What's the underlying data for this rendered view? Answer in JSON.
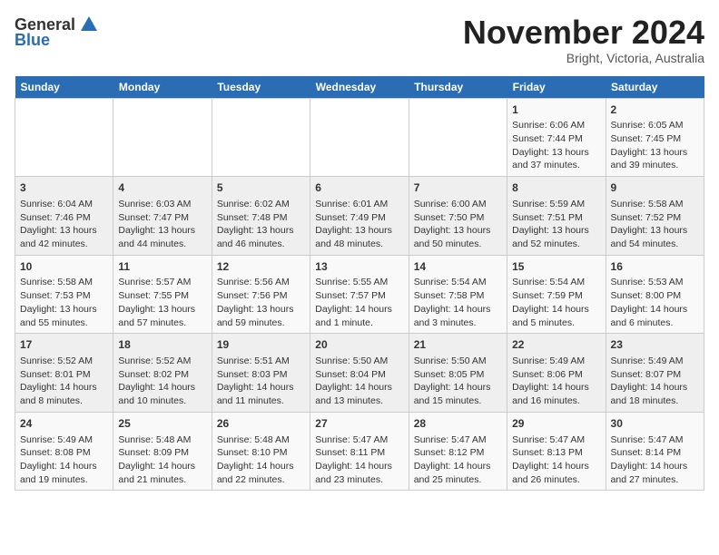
{
  "header": {
    "logo_general": "General",
    "logo_blue": "Blue",
    "month_year": "November 2024",
    "location": "Bright, Victoria, Australia"
  },
  "weekdays": [
    "Sunday",
    "Monday",
    "Tuesday",
    "Wednesday",
    "Thursday",
    "Friday",
    "Saturday"
  ],
  "weeks": [
    [
      {
        "day": "",
        "content": ""
      },
      {
        "day": "",
        "content": ""
      },
      {
        "day": "",
        "content": ""
      },
      {
        "day": "",
        "content": ""
      },
      {
        "day": "",
        "content": ""
      },
      {
        "day": "1",
        "content": "Sunrise: 6:06 AM\nSunset: 7:44 PM\nDaylight: 13 hours and 37 minutes."
      },
      {
        "day": "2",
        "content": "Sunrise: 6:05 AM\nSunset: 7:45 PM\nDaylight: 13 hours and 39 minutes."
      }
    ],
    [
      {
        "day": "3",
        "content": "Sunrise: 6:04 AM\nSunset: 7:46 PM\nDaylight: 13 hours and 42 minutes."
      },
      {
        "day": "4",
        "content": "Sunrise: 6:03 AM\nSunset: 7:47 PM\nDaylight: 13 hours and 44 minutes."
      },
      {
        "day": "5",
        "content": "Sunrise: 6:02 AM\nSunset: 7:48 PM\nDaylight: 13 hours and 46 minutes."
      },
      {
        "day": "6",
        "content": "Sunrise: 6:01 AM\nSunset: 7:49 PM\nDaylight: 13 hours and 48 minutes."
      },
      {
        "day": "7",
        "content": "Sunrise: 6:00 AM\nSunset: 7:50 PM\nDaylight: 13 hours and 50 minutes."
      },
      {
        "day": "8",
        "content": "Sunrise: 5:59 AM\nSunset: 7:51 PM\nDaylight: 13 hours and 52 minutes."
      },
      {
        "day": "9",
        "content": "Sunrise: 5:58 AM\nSunset: 7:52 PM\nDaylight: 13 hours and 54 minutes."
      }
    ],
    [
      {
        "day": "10",
        "content": "Sunrise: 5:58 AM\nSunset: 7:53 PM\nDaylight: 13 hours and 55 minutes."
      },
      {
        "day": "11",
        "content": "Sunrise: 5:57 AM\nSunset: 7:55 PM\nDaylight: 13 hours and 57 minutes."
      },
      {
        "day": "12",
        "content": "Sunrise: 5:56 AM\nSunset: 7:56 PM\nDaylight: 13 hours and 59 minutes."
      },
      {
        "day": "13",
        "content": "Sunrise: 5:55 AM\nSunset: 7:57 PM\nDaylight: 14 hours and 1 minute."
      },
      {
        "day": "14",
        "content": "Sunrise: 5:54 AM\nSunset: 7:58 PM\nDaylight: 14 hours and 3 minutes."
      },
      {
        "day": "15",
        "content": "Sunrise: 5:54 AM\nSunset: 7:59 PM\nDaylight: 14 hours and 5 minutes."
      },
      {
        "day": "16",
        "content": "Sunrise: 5:53 AM\nSunset: 8:00 PM\nDaylight: 14 hours and 6 minutes."
      }
    ],
    [
      {
        "day": "17",
        "content": "Sunrise: 5:52 AM\nSunset: 8:01 PM\nDaylight: 14 hours and 8 minutes."
      },
      {
        "day": "18",
        "content": "Sunrise: 5:52 AM\nSunset: 8:02 PM\nDaylight: 14 hours and 10 minutes."
      },
      {
        "day": "19",
        "content": "Sunrise: 5:51 AM\nSunset: 8:03 PM\nDaylight: 14 hours and 11 minutes."
      },
      {
        "day": "20",
        "content": "Sunrise: 5:50 AM\nSunset: 8:04 PM\nDaylight: 14 hours and 13 minutes."
      },
      {
        "day": "21",
        "content": "Sunrise: 5:50 AM\nSunset: 8:05 PM\nDaylight: 14 hours and 15 minutes."
      },
      {
        "day": "22",
        "content": "Sunrise: 5:49 AM\nSunset: 8:06 PM\nDaylight: 14 hours and 16 minutes."
      },
      {
        "day": "23",
        "content": "Sunrise: 5:49 AM\nSunset: 8:07 PM\nDaylight: 14 hours and 18 minutes."
      }
    ],
    [
      {
        "day": "24",
        "content": "Sunrise: 5:49 AM\nSunset: 8:08 PM\nDaylight: 14 hours and 19 minutes."
      },
      {
        "day": "25",
        "content": "Sunrise: 5:48 AM\nSunset: 8:09 PM\nDaylight: 14 hours and 21 minutes."
      },
      {
        "day": "26",
        "content": "Sunrise: 5:48 AM\nSunset: 8:10 PM\nDaylight: 14 hours and 22 minutes."
      },
      {
        "day": "27",
        "content": "Sunrise: 5:47 AM\nSunset: 8:11 PM\nDaylight: 14 hours and 23 minutes."
      },
      {
        "day": "28",
        "content": "Sunrise: 5:47 AM\nSunset: 8:12 PM\nDaylight: 14 hours and 25 minutes."
      },
      {
        "day": "29",
        "content": "Sunrise: 5:47 AM\nSunset: 8:13 PM\nDaylight: 14 hours and 26 minutes."
      },
      {
        "day": "30",
        "content": "Sunrise: 5:47 AM\nSunset: 8:14 PM\nDaylight: 14 hours and 27 minutes."
      }
    ]
  ]
}
